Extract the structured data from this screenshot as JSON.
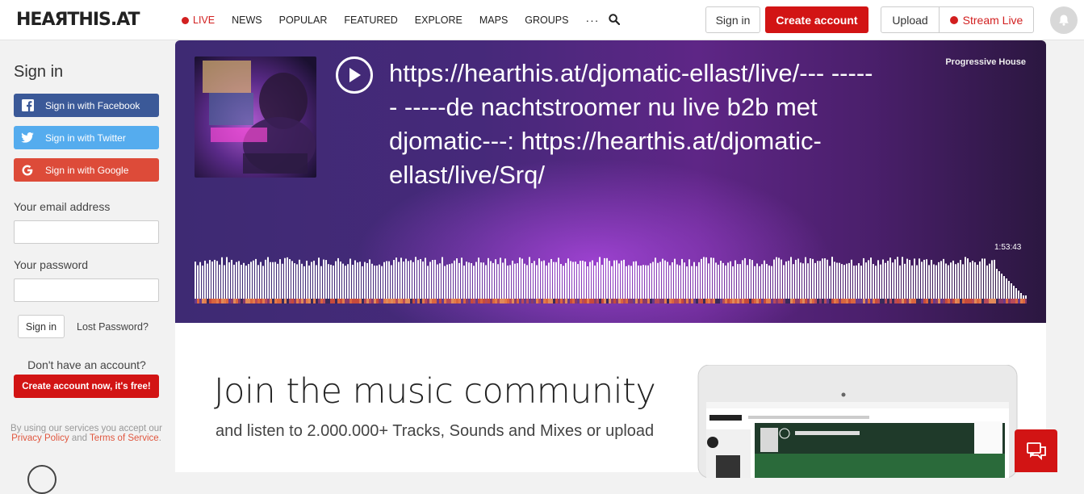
{
  "header": {
    "logo": "HEAЯTHIS.AT",
    "nav": [
      {
        "label": "LIVE"
      },
      {
        "label": "NEWS"
      },
      {
        "label": "POPULAR"
      },
      {
        "label": "FEATURED"
      },
      {
        "label": "EXPLORE"
      },
      {
        "label": "MAPS"
      },
      {
        "label": "GROUPS"
      }
    ],
    "more": "···",
    "signin": "Sign in",
    "create_account": "Create account",
    "upload": "Upload",
    "stream_live": "Stream Live",
    "accent": "#d21414"
  },
  "sidebar": {
    "title": "Sign in",
    "facebook": "Sign in with Facebook",
    "twitter": "Sign in with Twitter",
    "google": "Sign in with Google",
    "email_label": "Your email address",
    "email_value": "",
    "password_label": "Your password",
    "password_value": "",
    "signin_button": "Sign in",
    "lost_password": "Lost Password?",
    "no_account": "Don't have an account?",
    "create_free": "Create account now, it's free!",
    "terms_prefix": "By using our services you accept our ",
    "privacy": "Privacy Policy",
    "and": " and ",
    "terms": "Terms of Service",
    "terms_end": "."
  },
  "player": {
    "title": "https://hearthis.at/djomatic-ellast/live/--- ------ -----de nachtstroomer nu live b2b met djomatic---: https://hearthis.at/djomatic-ellast/live/Srq/",
    "genre": "Progressive House",
    "duration": "1:53:43"
  },
  "promo": {
    "headline": "Join the music community",
    "subline": "and listen to 2.000.000+ Tracks, Sounds and Mixes or upload"
  }
}
